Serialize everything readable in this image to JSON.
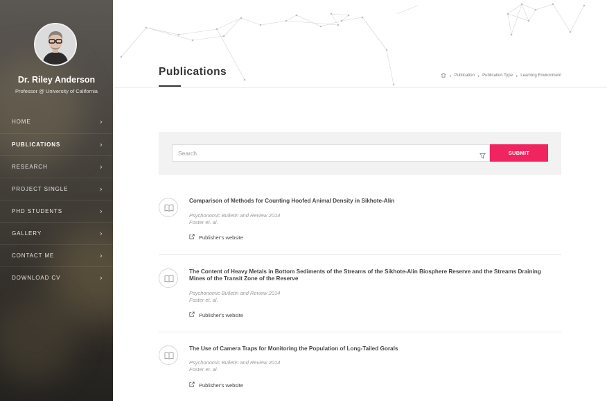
{
  "sidebar": {
    "name": "Dr. Riley Anderson",
    "role": "Professor @ University of California",
    "nav": [
      {
        "label": "HOME",
        "active": false
      },
      {
        "label": "PUBLICATIONS",
        "active": true
      },
      {
        "label": "RESEARCH",
        "active": false
      },
      {
        "label": "PROJECT SINGLE",
        "active": false
      },
      {
        "label": "PHD STUDENTS",
        "active": false
      },
      {
        "label": "GALLERY",
        "active": false
      },
      {
        "label": "CONTACT ME",
        "active": false
      },
      {
        "label": "DOWNLOAD CV",
        "active": false
      }
    ]
  },
  "header": {
    "title": "Publications",
    "breadcrumb": [
      "Publication",
      "Publication Type",
      "Learning Environment"
    ]
  },
  "search": {
    "placeholder": "Search",
    "submit_label": "SUBMIT"
  },
  "publications": [
    {
      "title": "Comparison of Methods for Counting Hoofed Animal Density in Sikhote-Alin",
      "journal": "Psychonomic Bulletin and Review 2014",
      "authors": "Foster et. al.",
      "link_label": "Publisher's website"
    },
    {
      "title": "The Content of Heavy Metals in Bottom Sediments of the Streams of the Sikhote-Alin Biosphere Reserve and the Streams Draining Mines of the Transit Zone of the Reserve",
      "journal": "Psychonomic Bulletin and Review 2014",
      "authors": "Foster et. al.",
      "link_label": "Publisher's website"
    },
    {
      "title": "The Use of Camera Traps for Monitoring the Population of Long-Tailed Gorals",
      "journal": "Psychonomic Bulletin and Review 2014",
      "authors": "Foster et. al.",
      "link_label": "Publisher's website"
    }
  ],
  "colors": {
    "accent": "#f0245e",
    "sidebar_bg": "#4a4641"
  }
}
